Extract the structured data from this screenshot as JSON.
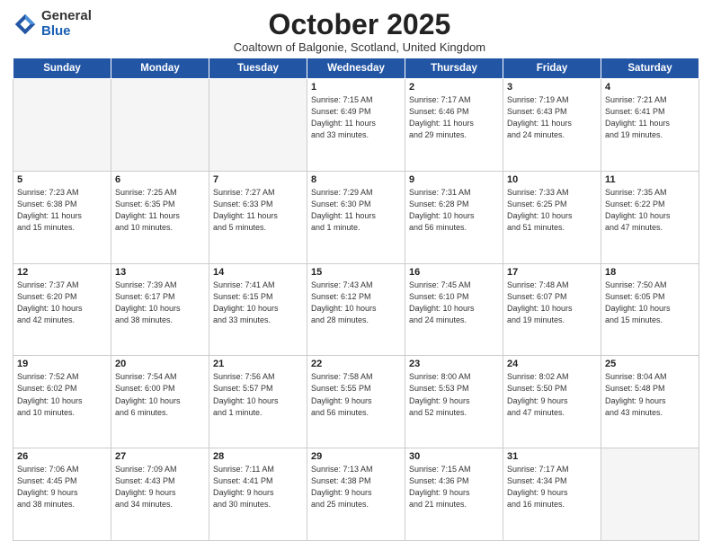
{
  "logo": {
    "general": "General",
    "blue": "Blue"
  },
  "title": "October 2025",
  "subtitle": "Coaltown of Balgonie, Scotland, United Kingdom",
  "days_header": [
    "Sunday",
    "Monday",
    "Tuesday",
    "Wednesday",
    "Thursday",
    "Friday",
    "Saturday"
  ],
  "weeks": [
    [
      {
        "day": "",
        "info": ""
      },
      {
        "day": "",
        "info": ""
      },
      {
        "day": "",
        "info": ""
      },
      {
        "day": "1",
        "info": "Sunrise: 7:15 AM\nSunset: 6:49 PM\nDaylight: 11 hours\nand 33 minutes."
      },
      {
        "day": "2",
        "info": "Sunrise: 7:17 AM\nSunset: 6:46 PM\nDaylight: 11 hours\nand 29 minutes."
      },
      {
        "day": "3",
        "info": "Sunrise: 7:19 AM\nSunset: 6:43 PM\nDaylight: 11 hours\nand 24 minutes."
      },
      {
        "day": "4",
        "info": "Sunrise: 7:21 AM\nSunset: 6:41 PM\nDaylight: 11 hours\nand 19 minutes."
      }
    ],
    [
      {
        "day": "5",
        "info": "Sunrise: 7:23 AM\nSunset: 6:38 PM\nDaylight: 11 hours\nand 15 minutes."
      },
      {
        "day": "6",
        "info": "Sunrise: 7:25 AM\nSunset: 6:35 PM\nDaylight: 11 hours\nand 10 minutes."
      },
      {
        "day": "7",
        "info": "Sunrise: 7:27 AM\nSunset: 6:33 PM\nDaylight: 11 hours\nand 5 minutes."
      },
      {
        "day": "8",
        "info": "Sunrise: 7:29 AM\nSunset: 6:30 PM\nDaylight: 11 hours\nand 1 minute."
      },
      {
        "day": "9",
        "info": "Sunrise: 7:31 AM\nSunset: 6:28 PM\nDaylight: 10 hours\nand 56 minutes."
      },
      {
        "day": "10",
        "info": "Sunrise: 7:33 AM\nSunset: 6:25 PM\nDaylight: 10 hours\nand 51 minutes."
      },
      {
        "day": "11",
        "info": "Sunrise: 7:35 AM\nSunset: 6:22 PM\nDaylight: 10 hours\nand 47 minutes."
      }
    ],
    [
      {
        "day": "12",
        "info": "Sunrise: 7:37 AM\nSunset: 6:20 PM\nDaylight: 10 hours\nand 42 minutes."
      },
      {
        "day": "13",
        "info": "Sunrise: 7:39 AM\nSunset: 6:17 PM\nDaylight: 10 hours\nand 38 minutes."
      },
      {
        "day": "14",
        "info": "Sunrise: 7:41 AM\nSunset: 6:15 PM\nDaylight: 10 hours\nand 33 minutes."
      },
      {
        "day": "15",
        "info": "Sunrise: 7:43 AM\nSunset: 6:12 PM\nDaylight: 10 hours\nand 28 minutes."
      },
      {
        "day": "16",
        "info": "Sunrise: 7:45 AM\nSunset: 6:10 PM\nDaylight: 10 hours\nand 24 minutes."
      },
      {
        "day": "17",
        "info": "Sunrise: 7:48 AM\nSunset: 6:07 PM\nDaylight: 10 hours\nand 19 minutes."
      },
      {
        "day": "18",
        "info": "Sunrise: 7:50 AM\nSunset: 6:05 PM\nDaylight: 10 hours\nand 15 minutes."
      }
    ],
    [
      {
        "day": "19",
        "info": "Sunrise: 7:52 AM\nSunset: 6:02 PM\nDaylight: 10 hours\nand 10 minutes."
      },
      {
        "day": "20",
        "info": "Sunrise: 7:54 AM\nSunset: 6:00 PM\nDaylight: 10 hours\nand 6 minutes."
      },
      {
        "day": "21",
        "info": "Sunrise: 7:56 AM\nSunset: 5:57 PM\nDaylight: 10 hours\nand 1 minute."
      },
      {
        "day": "22",
        "info": "Sunrise: 7:58 AM\nSunset: 5:55 PM\nDaylight: 9 hours\nand 56 minutes."
      },
      {
        "day": "23",
        "info": "Sunrise: 8:00 AM\nSunset: 5:53 PM\nDaylight: 9 hours\nand 52 minutes."
      },
      {
        "day": "24",
        "info": "Sunrise: 8:02 AM\nSunset: 5:50 PM\nDaylight: 9 hours\nand 47 minutes."
      },
      {
        "day": "25",
        "info": "Sunrise: 8:04 AM\nSunset: 5:48 PM\nDaylight: 9 hours\nand 43 minutes."
      }
    ],
    [
      {
        "day": "26",
        "info": "Sunrise: 7:06 AM\nSunset: 4:45 PM\nDaylight: 9 hours\nand 38 minutes."
      },
      {
        "day": "27",
        "info": "Sunrise: 7:09 AM\nSunset: 4:43 PM\nDaylight: 9 hours\nand 34 minutes."
      },
      {
        "day": "28",
        "info": "Sunrise: 7:11 AM\nSunset: 4:41 PM\nDaylight: 9 hours\nand 30 minutes."
      },
      {
        "day": "29",
        "info": "Sunrise: 7:13 AM\nSunset: 4:38 PM\nDaylight: 9 hours\nand 25 minutes."
      },
      {
        "day": "30",
        "info": "Sunrise: 7:15 AM\nSunset: 4:36 PM\nDaylight: 9 hours\nand 21 minutes."
      },
      {
        "day": "31",
        "info": "Sunrise: 7:17 AM\nSunset: 4:34 PM\nDaylight: 9 hours\nand 16 minutes."
      },
      {
        "day": "",
        "info": ""
      }
    ]
  ]
}
